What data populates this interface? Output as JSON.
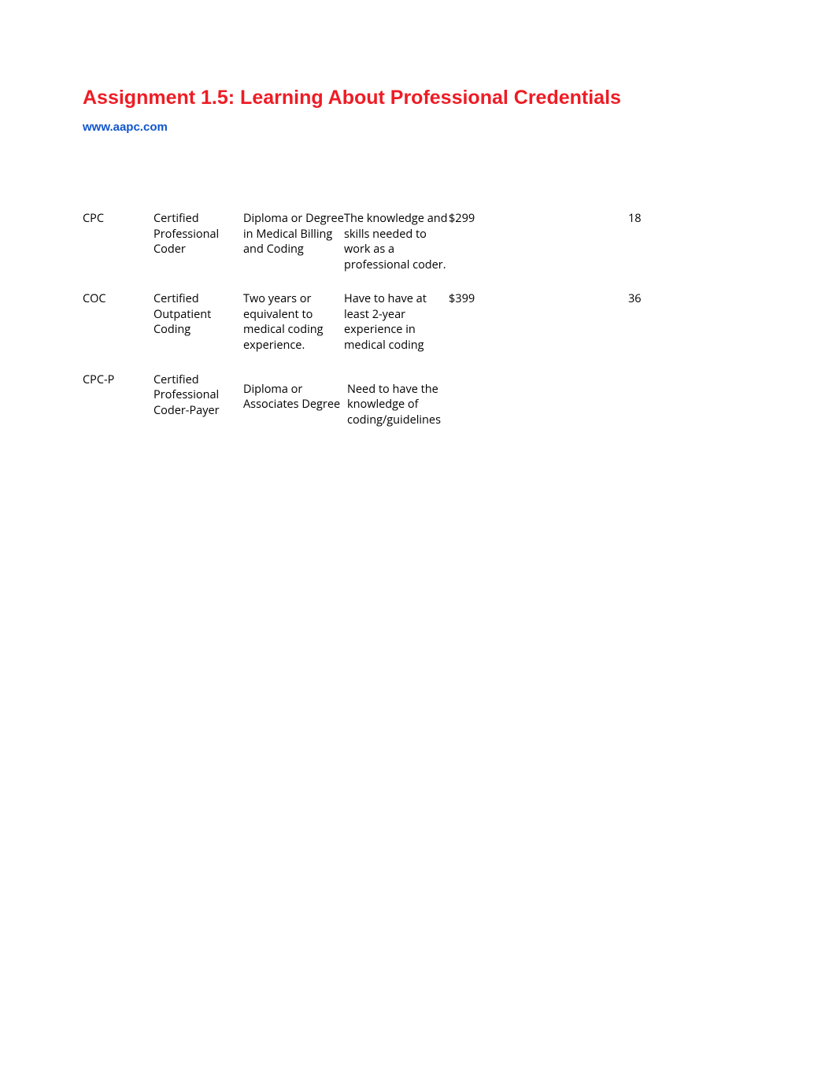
{
  "title": "Assignment 1.5: Learning About Professional Credentials",
  "link": "www.aapc.com",
  "rows": [
    {
      "code": "CPC",
      "name": "Certified Professional Coder",
      "education": "Diploma or Degree in Medical Billing and Coding",
      "requirement": "The knowledge and skills needed to work as a professional coder.",
      "cost": "$299",
      "ceus": "18"
    },
    {
      "code": "COC",
      "name": "Certified Outpatient Coding",
      "education": "Two years or equivalent to medical coding experience.",
      "requirement": "Have to have at least 2-year experience in medical coding",
      "cost": "$399",
      "ceus": "36"
    },
    {
      "code": "CPC-P",
      "name": "Certified Professional Coder-Payer",
      "education": "Diploma or Associates Degree",
      "requirement": "Need to have the knowledge of coding/guidelines",
      "cost": "",
      "ceus": ""
    }
  ]
}
